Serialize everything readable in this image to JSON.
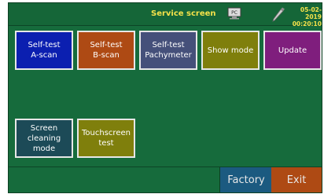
{
  "header": {
    "title": "Service screen",
    "date": "05-02-2019",
    "time": "00:20:10",
    "pc_icon_label": "PC"
  },
  "tiles": [
    {
      "label": "Self-test\nA-scan"
    },
    {
      "label": "Self-test\nB-scan"
    },
    {
      "label": "Self-test\nPachymeter"
    },
    {
      "label": "Show mode"
    },
    {
      "label": "Update"
    },
    {
      "label": "Screen\ncleaning\nmode"
    },
    {
      "label": "Touchscreen\ntest"
    }
  ],
  "bottom": {
    "factory_label": "Factory",
    "exit_label": "Exit"
  },
  "colors": {
    "background": "#166b3c",
    "header_text": "#f4e24a",
    "tile_border": "#e7e7e7",
    "a_scan": "#0b1fb0",
    "b_scan": "#ae4a14",
    "pachymeter": "#45507a",
    "show_mode": "#7f7f0c",
    "update": "#7f1e7d",
    "screen_cleaning": "#1c4a57",
    "touchscreen": "#7f7f0c",
    "factory": "#1b5a80",
    "exit": "#ae4a14"
  }
}
